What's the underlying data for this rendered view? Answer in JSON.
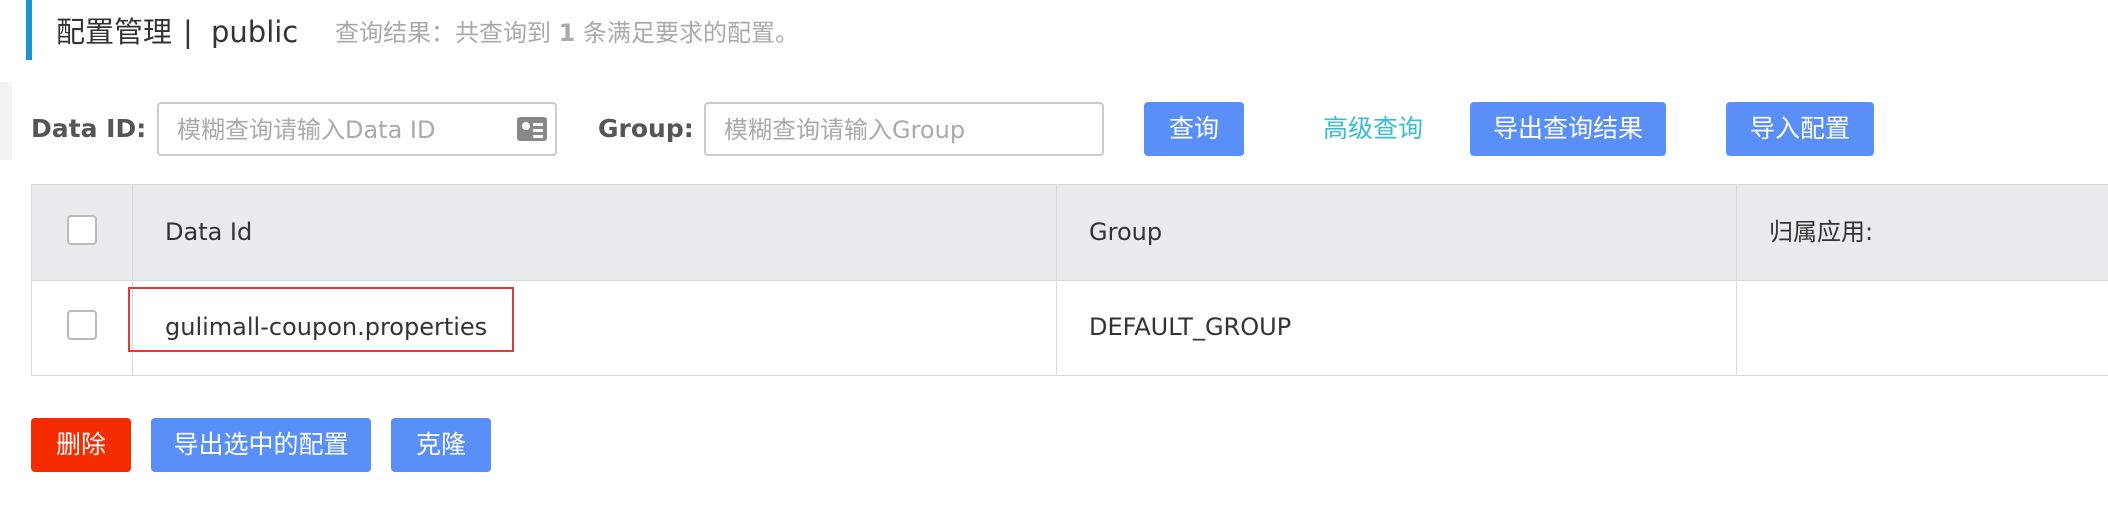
{
  "header": {
    "title": "配置管理",
    "separator": "|",
    "namespace": "public",
    "query_result_prefix": "查询结果：共查询到",
    "query_result_count": "1",
    "query_result_suffix": "条满足要求的配置。"
  },
  "filters": {
    "data_id_label": "Data ID:",
    "data_id_placeholder": "模糊查询请输入Data ID",
    "group_label": "Group:",
    "group_placeholder": "模糊查询请输入Group"
  },
  "toolbar": {
    "query_label": "查询",
    "advanced_query_label": "高级查询",
    "export_results_label": "导出查询结果",
    "import_config_label": "导入配置"
  },
  "table": {
    "columns": [
      "Data Id",
      "Group",
      "归属应用:"
    ],
    "rows": [
      {
        "data_id": "gulimall-coupon.properties",
        "group": "DEFAULT_GROUP",
        "app": ""
      }
    ]
  },
  "actions": {
    "delete_label": "删除",
    "export_selected_label": "导出选中的配置",
    "clone_label": "克隆"
  },
  "colors": {
    "primary": "#5a8ff7",
    "danger": "#f52c00",
    "link": "#3bbcd4",
    "header_accent": "#1f92d1"
  }
}
